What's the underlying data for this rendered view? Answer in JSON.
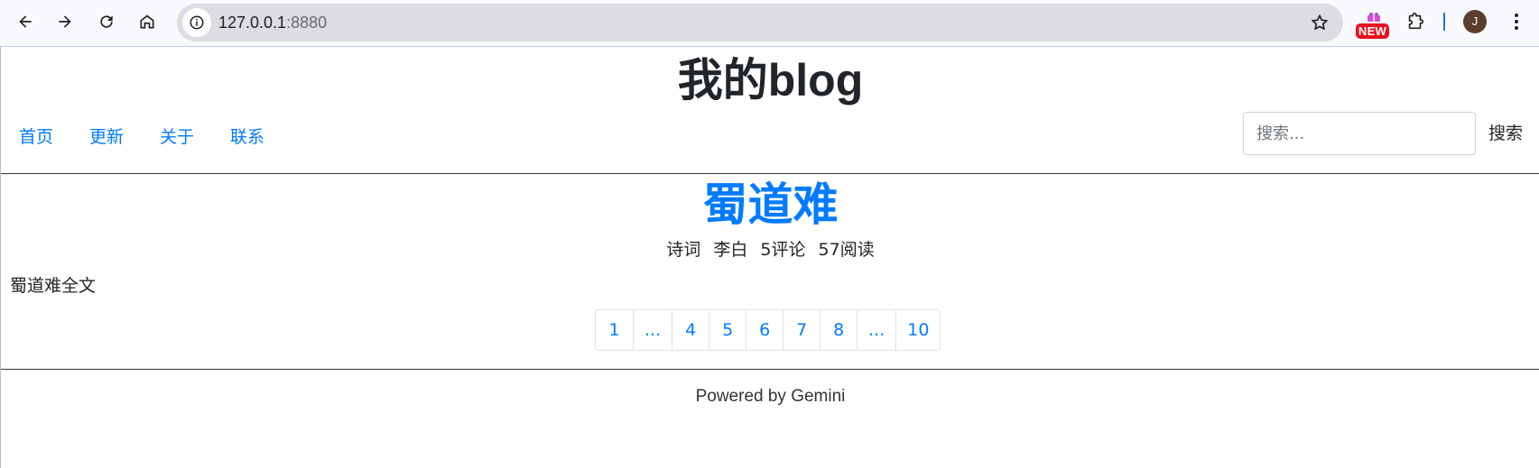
{
  "browser": {
    "url_host": "127.0.0.1",
    "url_port": ":8880",
    "extension_badge": "NEW",
    "profile_initial": "J"
  },
  "site": {
    "title": "我的blog",
    "nav": [
      "首页",
      "更新",
      "关于",
      "联系"
    ],
    "search_placeholder": "搜索...",
    "search_button": "搜索"
  },
  "article": {
    "title": "蜀道难",
    "category": "诗词",
    "author": "李白",
    "comments": "5评论",
    "views": "57阅读",
    "excerpt": "蜀道难全文"
  },
  "pagination": [
    "1",
    "...",
    "4",
    "5",
    "6",
    "7",
    "8",
    "...",
    "10"
  ],
  "footer": "Powered by Gemini"
}
